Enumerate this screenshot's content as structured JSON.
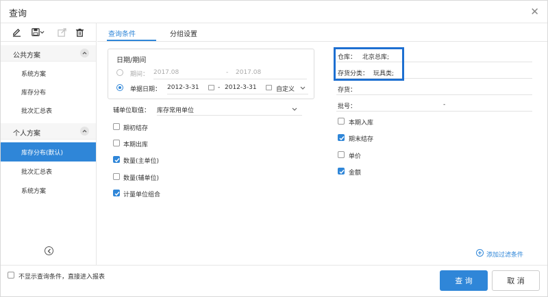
{
  "window": {
    "title": "查询"
  },
  "sidebar": {
    "public_group": {
      "label": "公共方案",
      "items": [
        "系统方案",
        "库存分布",
        "批次汇总表"
      ]
    },
    "personal_group": {
      "label": "个人方案",
      "items": [
        "库存分布(默认)",
        "批次汇总表",
        "系统方案"
      ]
    }
  },
  "tabs": [
    "查询条件",
    "分组设置"
  ],
  "date_section": {
    "title": "日期/期间",
    "period_label": "期间：",
    "period_from": "2017.08",
    "period_sep": "-",
    "period_to": "2017.08",
    "docdate_label": "单据日期：",
    "date_from": "2012-3-31",
    "date_sep": "-",
    "date_to": "2012-3-31",
    "mode": "自定义"
  },
  "aux_unit": {
    "label": "辅单位取值：",
    "value": "库存常用单位"
  },
  "left_checks": [
    {
      "label": "期初结存",
      "checked": false
    },
    {
      "label": "本期出库",
      "checked": false
    },
    {
      "label": "数量(主单位)",
      "checked": true
    },
    {
      "label": "数量(辅单位)",
      "checked": false
    },
    {
      "label": "计量单位组合",
      "checked": true
    }
  ],
  "filters": {
    "warehouse": {
      "label": "仓库：",
      "value": "北京总库;"
    },
    "category": {
      "label": "存货分类：",
      "value": "玩具类;"
    },
    "inventory": {
      "label": "存货："
    },
    "batch": {
      "label": "批号：",
      "sep": "-"
    }
  },
  "right_checks": [
    {
      "label": "本期入库",
      "checked": false
    },
    {
      "label": "期末结存",
      "checked": true
    },
    {
      "label": "单价",
      "checked": false
    },
    {
      "label": "金额",
      "checked": true
    }
  ],
  "add_filter_label": "添加过滤条件",
  "footer": {
    "skip_label": "不显示查询条件，直接进入报表",
    "query_button": "查 询",
    "cancel_button": "取 消"
  },
  "colors": {
    "accent": "#2f86d8",
    "highlight": "#1d6fd1"
  }
}
